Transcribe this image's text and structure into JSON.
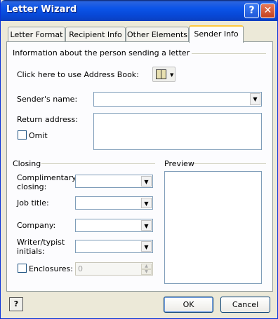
{
  "window": {
    "title": "Letter Wizard"
  },
  "titlebar": {
    "help_glyph": "?",
    "close_glyph": "✕"
  },
  "tabs": [
    {
      "label": "Letter Format"
    },
    {
      "label": "Recipient Info"
    },
    {
      "label": "Other Elements"
    },
    {
      "label": "Sender Info",
      "active": true
    }
  ],
  "sender": {
    "section_heading": "Information about the person sending a letter",
    "address_book_label": "Click here to use Address Book:",
    "address_book_icon": "address-book-icon",
    "name_label": "Sender's name:",
    "name_value": "",
    "return_address_label": "Return address:",
    "return_address_value": "",
    "omit_label": "Omit",
    "omit_checked": false
  },
  "closing": {
    "heading": "Closing",
    "complimentary_label": "Complimentary closing:",
    "complimentary_value": "",
    "job_title_label": "Job title:",
    "job_title_value": "",
    "company_label": "Company:",
    "company_value": "",
    "writer_initials_label": "Writer/typist initials:",
    "writer_initials_value": "",
    "enclosures_label": "Enclosures:",
    "enclosures_checked": false,
    "enclosures_value": "0"
  },
  "preview": {
    "heading": "Preview"
  },
  "footer": {
    "help_icon": "help-question-icon",
    "ok_label": "OK",
    "cancel_label": "Cancel"
  }
}
